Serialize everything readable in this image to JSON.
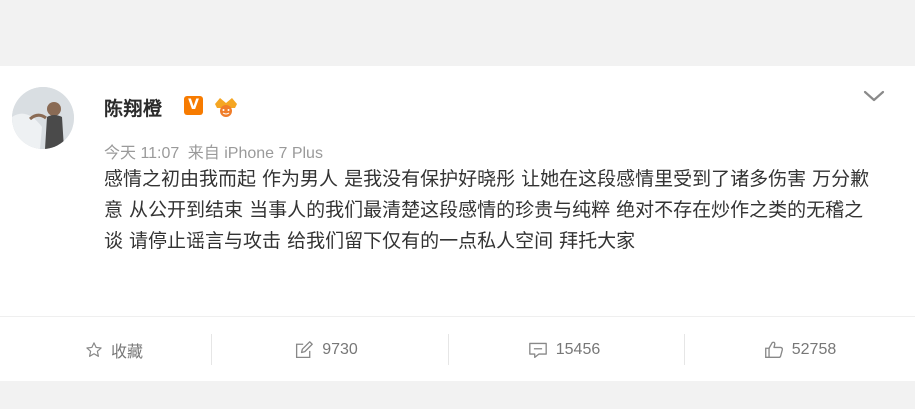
{
  "post": {
    "author": "陈翔橙",
    "verified_badge": "V",
    "time": "今天 11:07",
    "source": "来自 iPhone 7 Plus",
    "text": "感情之初由我而起 作为男人 是我没有保护好晓彤 让她在这段感情里受到了诸多伤害 万分歉意 从公开到结束 当事人的我们最清楚这段感情的珍贵与纯粹 绝对不存在炒作之类的无稽之谈 请停止谣言与攻击 给我们留下仅有的一点私人空间 拜托大家"
  },
  "actions": {
    "favorite_label": "收藏",
    "repost_count": "9730",
    "comment_count": "15456",
    "like_count": "52758"
  },
  "icons": {
    "favorite": "star-outline-icon",
    "repost": "share-edit-icon",
    "comment": "comment-bubble-icon",
    "like": "thumbs-up-icon",
    "menu": "chevron-down-icon"
  },
  "colors": {
    "verified_badge": "#f77b00",
    "author_text": "#2b2b2b",
    "meta_text": "#9a9a9a",
    "body_text": "#333333",
    "action_text": "#777777"
  }
}
